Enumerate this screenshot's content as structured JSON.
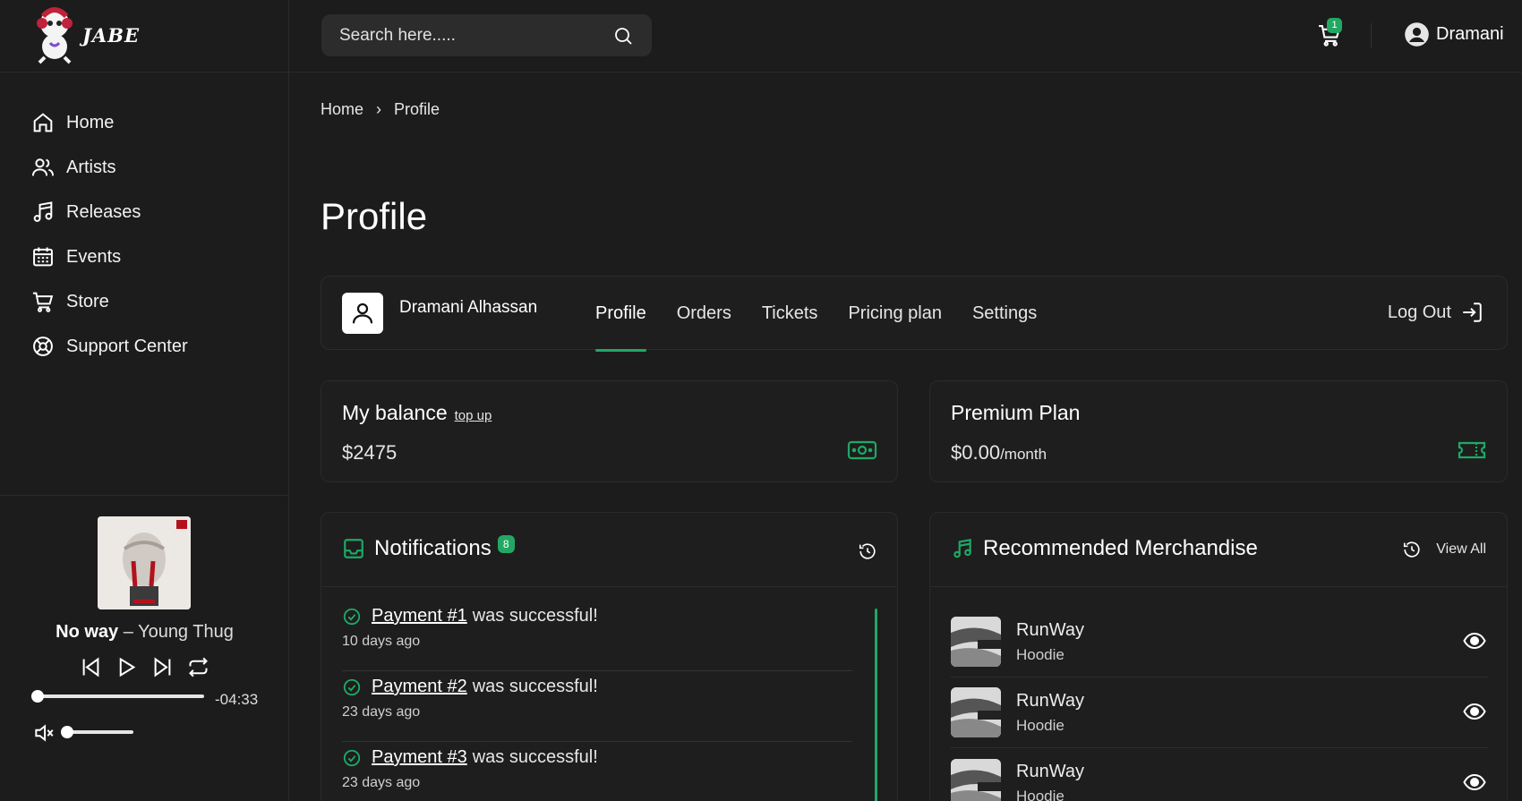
{
  "brand": {
    "name": "JABE"
  },
  "sidebar": {
    "items": [
      {
        "label": "Home",
        "icon": "home-icon"
      },
      {
        "label": "Artists",
        "icon": "users-icon"
      },
      {
        "label": "Releases",
        "icon": "music-note-icon"
      },
      {
        "label": "Events",
        "icon": "calendar-icon"
      },
      {
        "label": "Store",
        "icon": "cart-icon"
      },
      {
        "label": "Support Center",
        "icon": "support-icon"
      }
    ]
  },
  "player": {
    "title": "No way",
    "separator": " – ",
    "artist": "Young Thug",
    "remaining": "-04:33",
    "progress": 0,
    "volume": 0
  },
  "header": {
    "search_placeholder": "Search here.....",
    "cart_count": "1",
    "username": "Dramani"
  },
  "breadcrumb": {
    "home": "Home",
    "separator": "›",
    "current": "Profile"
  },
  "page_title": "Profile",
  "profile": {
    "full_name": "Dramani Alhassan",
    "tabs": [
      "Profile",
      "Orders",
      "Tickets",
      "Pricing plan",
      "Settings"
    ],
    "active_tab": "Profile",
    "logout_label": "Log Out"
  },
  "balance": {
    "label": "My balance",
    "topup_label": "top up",
    "value": "$2475"
  },
  "plan": {
    "label": "Premium Plan",
    "price": "$0.00",
    "period": "/month"
  },
  "notifications": {
    "title": "Notifications",
    "count": "8",
    "items": [
      {
        "link": "Payment #1",
        "text": "was successful!",
        "date": "10 days ago"
      },
      {
        "link": "Payment #2",
        "text": "was successful!",
        "date": "23 days ago"
      },
      {
        "link": "Payment #3",
        "text": "was successful!",
        "date": "23 days ago"
      }
    ]
  },
  "merch": {
    "title": "Recommended Merchandise",
    "view_all": "View All",
    "items": [
      {
        "name": "RunWay",
        "type": "Hoodie"
      },
      {
        "name": "RunWay",
        "type": "Hoodie"
      },
      {
        "name": "RunWay",
        "type": "Hoodie"
      }
    ]
  },
  "colors": {
    "accent": "#1fa866",
    "background": "#1c1c1c",
    "card": "#1e1e1e"
  }
}
